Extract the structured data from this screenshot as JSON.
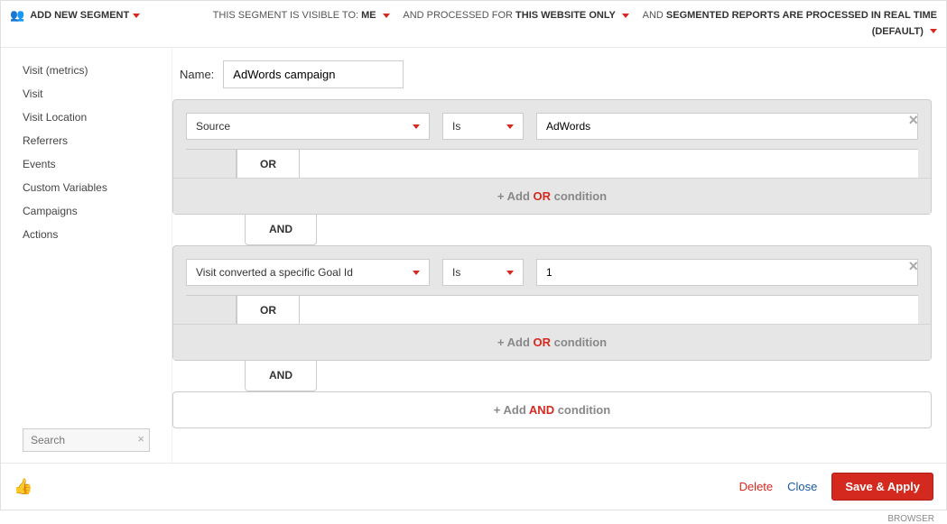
{
  "topbar": {
    "add_segment": "ADD NEW SEGMENT",
    "visible_prefix": "THIS SEGMENT IS VISIBLE TO: ",
    "visible_value": "ME",
    "processed_prefix": "AND PROCESSED FOR ",
    "processed_value": "THIS WEBSITE ONLY",
    "realtime_prefix": "AND ",
    "realtime_bold": "SEGMENTED REPORTS ARE PROCESSED IN REAL TIME",
    "realtime_default": "(DEFAULT)"
  },
  "sidebar": {
    "items": [
      {
        "label": "Visit (metrics)"
      },
      {
        "label": "Visit"
      },
      {
        "label": "Visit Location"
      },
      {
        "label": "Referrers"
      },
      {
        "label": "Events"
      },
      {
        "label": "Custom Variables"
      },
      {
        "label": "Campaigns"
      },
      {
        "label": "Actions"
      }
    ],
    "search_placeholder": "Search"
  },
  "form": {
    "name_label": "Name:",
    "name_value": "AdWords campaign"
  },
  "blocks": [
    {
      "field": "Source",
      "operator": "Is",
      "value": "AdWords",
      "or_label": "OR",
      "add_or_prefix": "+ Add ",
      "add_or_kw": "OR",
      "add_or_suffix": " condition"
    },
    {
      "field": "Visit converted a specific Goal Id",
      "operator": "Is",
      "value": "1",
      "or_label": "OR",
      "add_or_prefix": "+ Add ",
      "add_or_kw": "OR",
      "add_or_suffix": " condition"
    }
  ],
  "and_label": "AND",
  "add_and": {
    "prefix": "+ Add ",
    "kw": "AND",
    "suffix": " condition"
  },
  "footer": {
    "delete": "Delete",
    "close": "Close",
    "save": "Save & Apply"
  },
  "below": {
    "right": "BROWSER"
  }
}
